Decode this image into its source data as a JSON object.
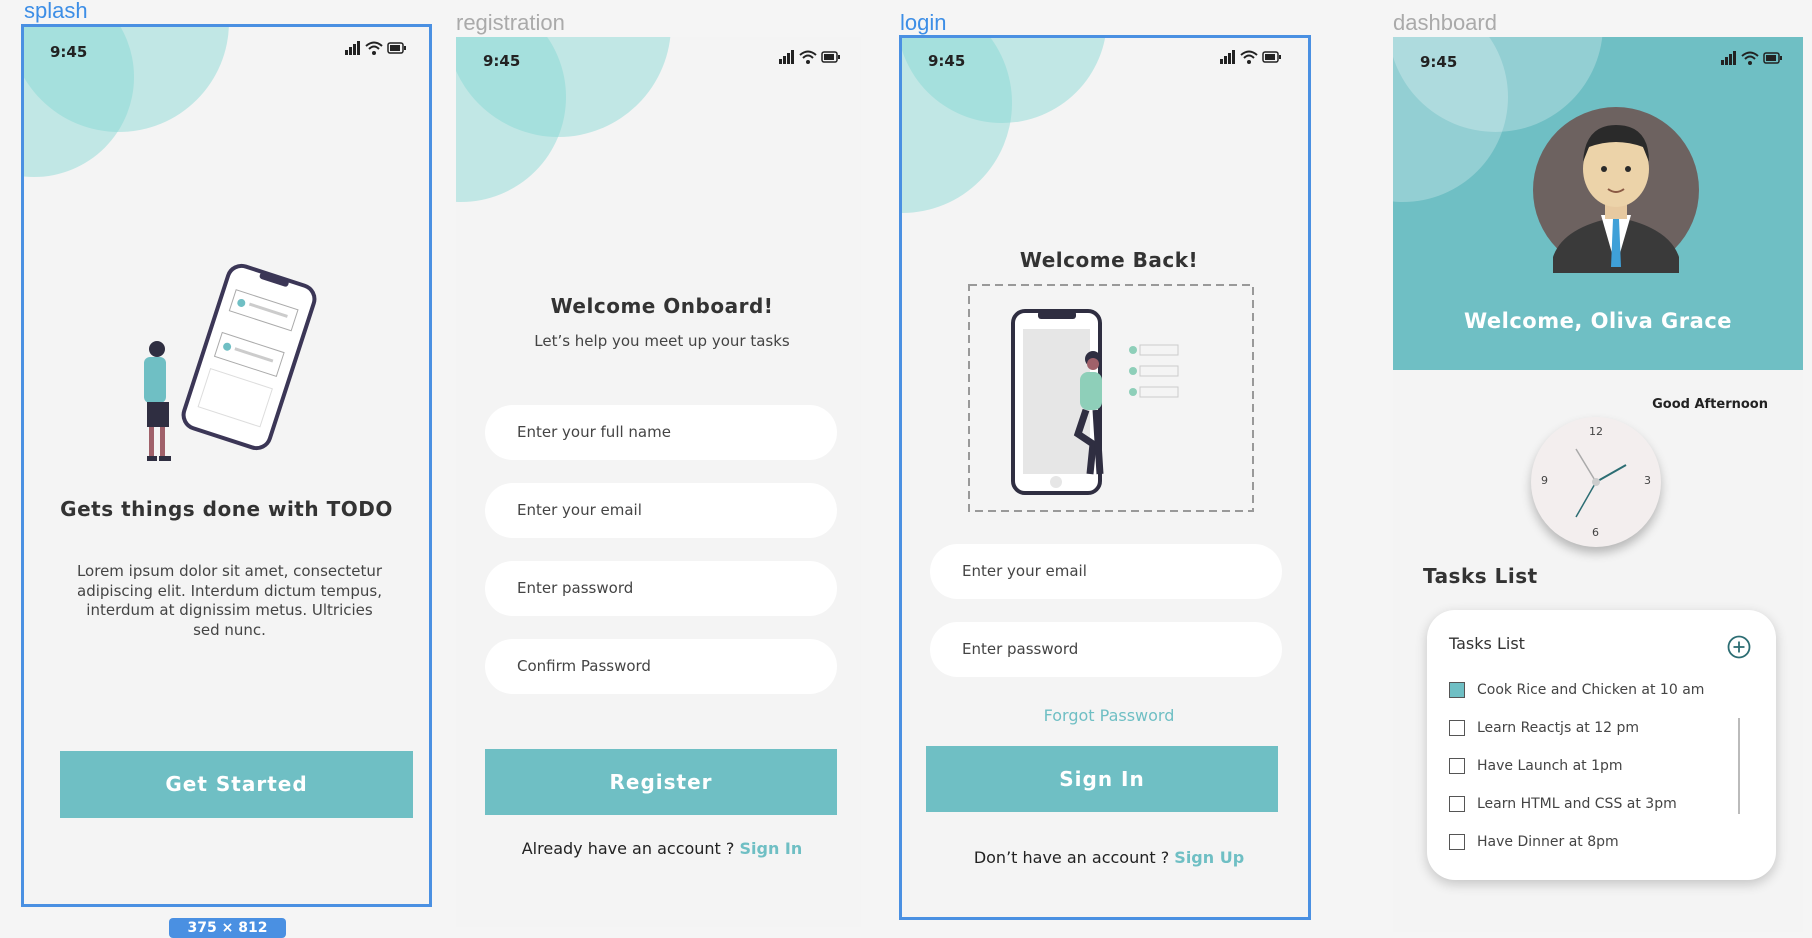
{
  "colors": {
    "accent": "#6fbfc4",
    "selection": "#4a90e2",
    "bubble": "#8ad8d3",
    "avatar_bg": "#6d6260"
  },
  "status_bar": {
    "time": "9:45",
    "icons": [
      "signal-icon",
      "wifi-icon",
      "battery-icon"
    ]
  },
  "frame_labels": {
    "splash": "splash",
    "registration": "registration",
    "login": "login",
    "dashboard": "dashboard"
  },
  "size_badge": "375 × 812",
  "splash": {
    "title": "Gets things done with TODO",
    "body": "Lorem ipsum dolor sit amet, consectetur adipiscing elit. Interdum dictum tempus, interdum at dignissim metus. Ultricies sed nunc.",
    "button": "Get Started"
  },
  "registration": {
    "title": "Welcome Onboard!",
    "subtitle": "Let’s help you meet up your tasks",
    "fields": [
      "Enter your full name",
      "Enter your email",
      "Enter password",
      "Confirm Password"
    ],
    "button": "Register",
    "footer_text": "Already have an account ? ",
    "footer_link": "Sign In"
  },
  "login": {
    "title": "Welcome Back!",
    "fields": [
      "Enter your email",
      "Enter password"
    ],
    "forgot": "Forgot Password",
    "button": "Sign In",
    "footer_text": "Don’t have an account ? ",
    "footer_link": "Sign Up"
  },
  "dashboard": {
    "welcome": "Welcome, Oliva Grace",
    "greeting": "Good Afternoon",
    "clock_numbers": {
      "top": "12",
      "right": "3",
      "bottom": "6",
      "left": "9"
    },
    "section_title": "Tasks List",
    "card_title": "Tasks List",
    "tasks": [
      {
        "label": "Cook Rice and Chicken at 10 am",
        "checked": true
      },
      {
        "label": "Learn Reactjs at 12 pm",
        "checked": false
      },
      {
        "label": "Have Launch  at 1pm",
        "checked": false
      },
      {
        "label": "Learn HTML and CSS at 3pm",
        "checked": false
      },
      {
        "label": "Have Dinner at 8pm",
        "checked": false
      }
    ]
  }
}
